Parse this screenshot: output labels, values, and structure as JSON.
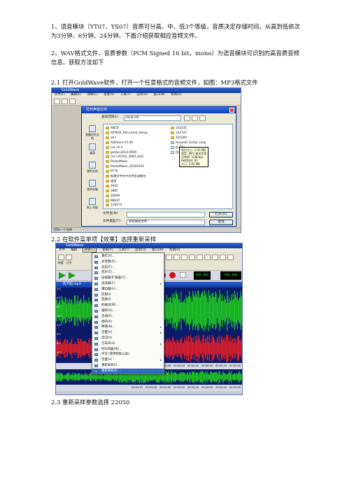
{
  "document": {
    "para1": "1、语音模块（YT07、YS07）音质可分高、中、低3个等级，音质决定存储时间，从高到低依次为3分钟、6分钟、24分钟。下面介绍获取相应音频文件。",
    "para2": "2、WAV格式文件、音质参数（PCM Signed 16 bit，mono）为语音模块可识别的高音质音频信息。获取方法如下",
    "caption1": "2.1 打开GoldWave软件，打开一个任意格式的音频文件，如图：MP3格式文件",
    "caption2": "2.2 在软件菜单项【效果】选择重新采样",
    "caption3": "2.3 重新采样参数选择  22050"
  },
  "screenshot1": {
    "app_title": "GoldWave",
    "menu": [
      "文件(F)",
      "编辑(E)",
      "效果(C)",
      "查看(V)",
      "工具(T)",
      "选项(O)",
      "窗口(W)",
      "帮助(H)"
    ],
    "dialog_title": "打开声音文件",
    "look_in_label": "查找范围(I):",
    "look_in_value": "local.cdr",
    "nav": [
      "我最近的文档",
      "桌面",
      "我的文档",
      "我的电脑",
      "网上邻居"
    ],
    "files_left": [
      "ABCD",
      "XIFROR_ReCurrent_Setup",
      "ab.l",
      "ADVdocs.V1.00",
      "cdr v5.4",
      "gsdoor2014.0909",
      "ms-cd1102_3060_fw2)",
      "PhotoMaker",
      "PhotoMaker_20100101",
      "PTT9",
      "新建文件夹中文件目录都包",
      "桌面",
      "2942",
      "3887",
      "20690",
      "98037",
      "126274"
    ],
    "files_right": [
      "142235",
      "142747",
      "151009",
      "Acoustic Guitar Loop",
      "伤不起",
      "伤不起"
    ],
    "tooltip": [
      "项目大小: 2.00 MB",
      "类型: MP3 格式声音",
      "比特率: 128kbps",
      "持续时间: 03",
      "大小: 2.00 MB"
    ],
    "filename_label": "文件名(N):",
    "filetype_label": "文件类型(T):",
    "filetype_value": "所有格式文件",
    "open_button": "打开(O)",
    "cancel_button": "取消",
    "status": "打开一个文件"
  },
  "screenshot2": {
    "app_title": "GoldWave",
    "menu": [
      "文件",
      "编辑",
      "效果(C)",
      "查看(V)",
      "工具(T)",
      "选项(O)",
      "窗口(W)",
      "帮助(H)"
    ],
    "toolbar1": [
      "新建",
      "打开"
    ],
    "time_display": "00:00",
    "time_display_right": "00:00",
    "track_title": "伤不起.mp3",
    "menu_items": [
      {
        "label": "重打(X)...",
        "sub": false
      },
      {
        "label": "多普勒(D)...",
        "sub": false
      },
      {
        "label": "动态(Y)...",
        "sub": false
      },
      {
        "label": "回声(E)...",
        "sub": false
      },
      {
        "label": "压缩器/扩展器(C)...",
        "sub": false
      },
      {
        "label": "滤波器(F)",
        "sub": true
      },
      {
        "label": "镶边器(G)...",
        "sub": false
      },
      {
        "label": "反相(I)",
        "sub": false
      },
      {
        "label": "回放(I)",
        "sub": false
      },
      {
        "label": "机械化(M)...",
        "sub": false
      },
      {
        "label": "偏移(O)...",
        "sub": false
      },
      {
        "label": "音调(P)...",
        "sub": false
      },
      {
        "label": "混响(R)",
        "sub": false
      },
      {
        "label": "降噪(N)...",
        "sub": true
      },
      {
        "label": "音量(V)",
        "sub": true
      },
      {
        "label": "反向(V)",
        "sub": false
      },
      {
        "label": "空白声(S)",
        "sub": true
      },
      {
        "label": "时间弯曲(W)...",
        "sub": false
      },
      {
        "label": "声音    (使用帮助以此)",
        "sub": false
      },
      {
        "label": "音量(V)",
        "sub": true
      },
      {
        "label": "重新采样(I)...",
        "sub": false
      },
      {
        "label": "重新采样(E)...",
        "sub": false
      }
    ],
    "selected_index": 21,
    "scale_left": [
      "1.0",
      "0.5",
      "0.0",
      "-0.5",
      "1.0",
      "0.5",
      "0.0",
      "-0.5"
    ],
    "timeline": [
      "00:03:20",
      "00:03:40",
      "00:04:00",
      "00:04:20",
      "00:04:40",
      "00:00:00",
      "00:00:20",
      "00:00:40"
    ],
    "colors": {
      "wave_green": "#1fc81f",
      "wave_red": "#e0202a",
      "wave_bg": "#0c1a6a",
      "title_blue": "#1c48c4"
    }
  }
}
